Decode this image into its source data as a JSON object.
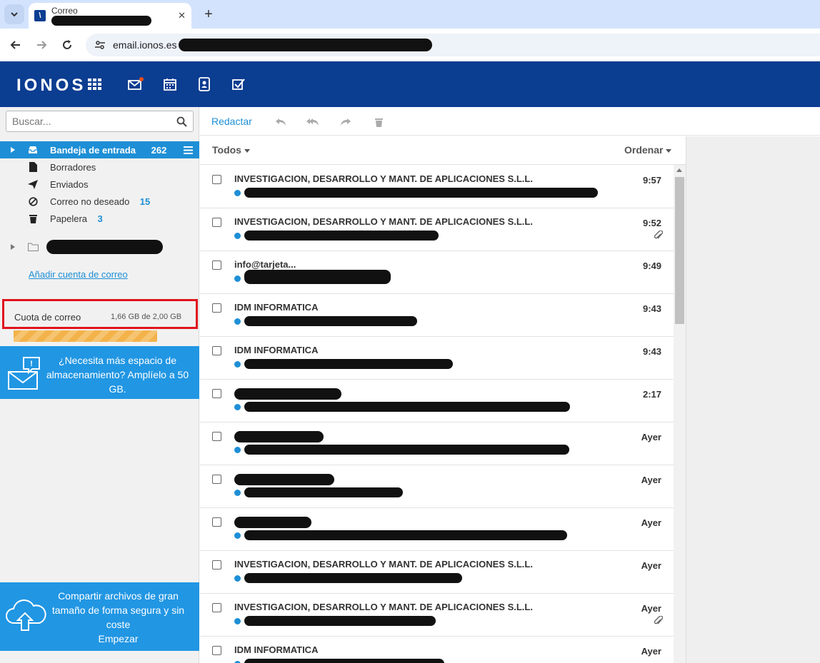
{
  "browser": {
    "tab_title": "Correo",
    "tab_close": "✕",
    "new_tab": "+",
    "url": "email.ionos.es"
  },
  "app": {
    "logo": "IONOS",
    "nav_icons": [
      "apps-icon",
      "mail-icon",
      "calendar-icon",
      "contacts-icon",
      "tasks-icon"
    ],
    "accent": "#1e8fd6",
    "header_color": "#0b3d91"
  },
  "sidebar": {
    "search_placeholder": "Buscar...",
    "folders": [
      {
        "label": "Bandeja de entrada",
        "count": "262",
        "icon": "inbox-icon"
      },
      {
        "label": "Borradores",
        "count": "",
        "icon": "draft-icon"
      },
      {
        "label": "Enviados",
        "count": "",
        "icon": "sent-icon"
      },
      {
        "label": "Correo no deseado",
        "count": "15",
        "icon": "spam-icon"
      },
      {
        "label": "Papelera",
        "count": "3",
        "icon": "trash-icon"
      }
    ],
    "add_account": "Añadir cuenta de correo",
    "quota_label": "Cuota de correo",
    "quota_value": "1,66 GB de 2,00 GB",
    "quota_fraction": 0.83,
    "promo_storage": "¿Necesita más espacio de almacenamiento? Amplíelo a 50 GB.",
    "promo_share": "Compartir archivos de gran tamaño de forma segura y sin coste",
    "promo_share_action": "Empezar"
  },
  "toolbar": {
    "compose": "Redactar"
  },
  "list": {
    "filter": "Todos",
    "sort": "Ordenar",
    "messages": [
      {
        "sender": "INVESTIGACION, DESARROLLO Y MANT. DE APLICACIONES S.L.L.",
        "time": "9:57",
        "attachment": false
      },
      {
        "sender": "INVESTIGACION, DESARROLLO Y MANT. DE APLICACIONES S.L.L.",
        "time": "9:52",
        "attachment": true
      },
      {
        "sender": "info@tarjeta...",
        "time": "9:49",
        "attachment": false
      },
      {
        "sender": "IDM INFORMATICA",
        "time": "9:43",
        "attachment": false
      },
      {
        "sender": "IDM INFORMATICA",
        "time": "9:43",
        "attachment": false
      },
      {
        "sender": "",
        "time": "2:17",
        "attachment": false
      },
      {
        "sender": "",
        "time": "Ayer",
        "attachment": false
      },
      {
        "sender": "",
        "time": "Ayer",
        "attachment": false
      },
      {
        "sender": "",
        "time": "Ayer",
        "attachment": false
      },
      {
        "sender": "INVESTIGACION, DESARROLLO Y MANT. DE APLICACIONES S.L.L.",
        "time": "Ayer",
        "attachment": false
      },
      {
        "sender": "INVESTIGACION, DESARROLLO Y MANT. DE APLICACIONES S.L.L.",
        "time": "Ayer",
        "attachment": true
      },
      {
        "sender": "IDM INFORMATICA",
        "time": "Ayer",
        "attachment": false
      }
    ]
  }
}
